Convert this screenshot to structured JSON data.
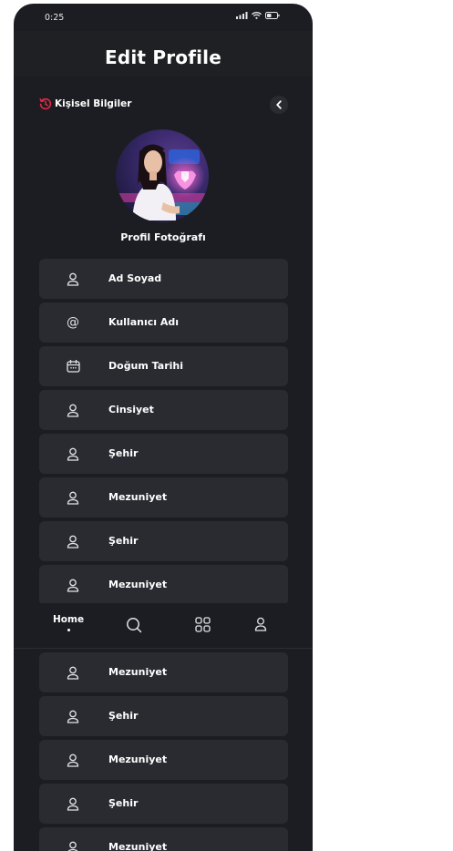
{
  "status_bar": {
    "time": "0:25"
  },
  "header": {
    "title": "Edit Profile"
  },
  "section": {
    "title": "Kişisel Bilgiler",
    "accent_color": "#e5283f"
  },
  "profile": {
    "photo_label": "Profil Fotoğrafı"
  },
  "fields": [
    {
      "label": "Ad Soyad",
      "icon": "user-icon"
    },
    {
      "label": "Kullanıcı Adı",
      "icon": "at-icon"
    },
    {
      "label": "Doğum Tarihi",
      "icon": "calendar-icon"
    },
    {
      "label": "Cinsiyet",
      "icon": "user-icon"
    },
    {
      "label": "Şehir",
      "icon": "user-icon"
    },
    {
      "label": "Mezuniyet",
      "icon": "user-icon"
    },
    {
      "label": "Şehir",
      "icon": "user-icon"
    },
    {
      "label": "Mezuniyet",
      "icon": "user-icon"
    },
    {
      "label": "Mezuniyet",
      "icon": "user-icon"
    },
    {
      "label": "Şehir",
      "icon": "user-icon"
    },
    {
      "label": "Mezuniyet",
      "icon": "user-icon"
    },
    {
      "label": "Şehir",
      "icon": "user-icon"
    },
    {
      "label": "Mezuniyet",
      "icon": "user-icon"
    }
  ],
  "bottom_nav": {
    "home_label": "Home",
    "items": [
      "home",
      "search-icon",
      "grid-icon",
      "profile-icon"
    ]
  }
}
